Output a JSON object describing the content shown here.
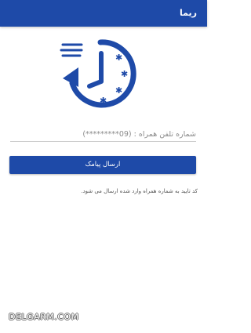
{
  "app_bar": {
    "title": "ریما"
  },
  "logo": {
    "icon": "fast-clock-icon",
    "color": "#1e4aa8"
  },
  "phone_input": {
    "placeholder": "شماره تلفن همراه : (09*********)",
    "value": ""
  },
  "send_button": {
    "label": "ارسال پیامک"
  },
  "info": {
    "text": "کد تایید به شماره همراه وارد شده ارسال می شود."
  },
  "watermark": {
    "text": "DELGARM.COM"
  },
  "colors": {
    "primary": "#1e4aa8",
    "background": "#ffffff"
  }
}
